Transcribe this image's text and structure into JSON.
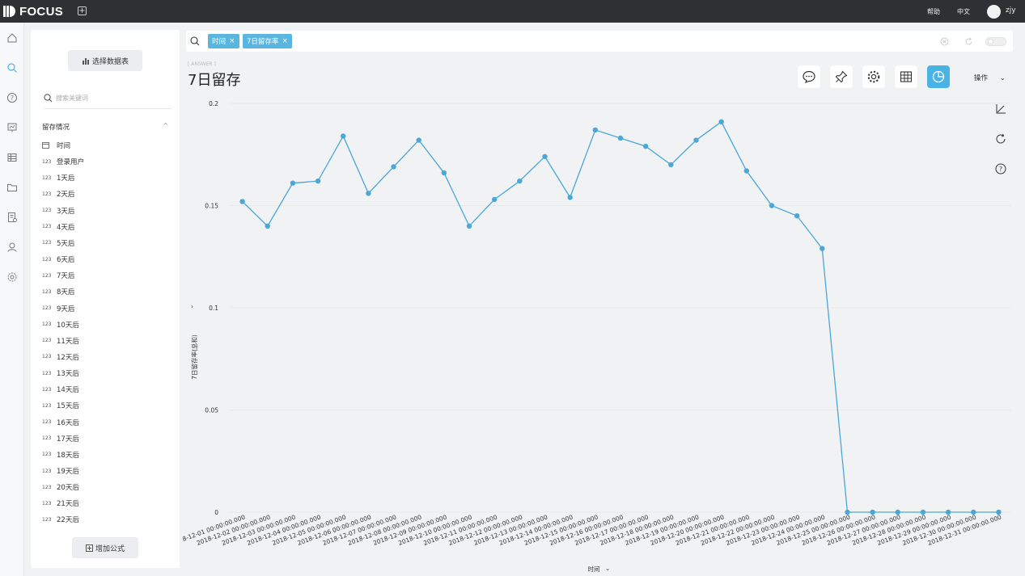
{
  "app": {
    "name": "FOCUS"
  },
  "topbar": {
    "help": "帮助",
    "lang": "中文",
    "user": "zjy"
  },
  "sidebar": {
    "select_table": "选择数据表",
    "search_placeholder": "搜索关键词",
    "group_title": "留存情况",
    "fields": [
      {
        "type": "date",
        "name": "时间"
      },
      {
        "type": "123",
        "name": "登录用户"
      },
      {
        "type": "123",
        "name": "1天后"
      },
      {
        "type": "123",
        "name": "2天后"
      },
      {
        "type": "123",
        "name": "3天后"
      },
      {
        "type": "123",
        "name": "4天后"
      },
      {
        "type": "123",
        "name": "5天后"
      },
      {
        "type": "123",
        "name": "6天后"
      },
      {
        "type": "123",
        "name": "7天后"
      },
      {
        "type": "123",
        "name": "8天后"
      },
      {
        "type": "123",
        "name": "9天后"
      },
      {
        "type": "123",
        "name": "10天后"
      },
      {
        "type": "123",
        "name": "11天后"
      },
      {
        "type": "123",
        "name": "12天后"
      },
      {
        "type": "123",
        "name": "13天后"
      },
      {
        "type": "123",
        "name": "14天后"
      },
      {
        "type": "123",
        "name": "15天后"
      },
      {
        "type": "123",
        "name": "16天后"
      },
      {
        "type": "123",
        "name": "17天后"
      },
      {
        "type": "123",
        "name": "18天后"
      },
      {
        "type": "123",
        "name": "19天后"
      },
      {
        "type": "123",
        "name": "20天后"
      },
      {
        "type": "123",
        "name": "21天后"
      },
      {
        "type": "123",
        "name": "22天后"
      }
    ],
    "add_formula": "增加公式"
  },
  "search": {
    "tokens": [
      "时间",
      "7日留存率"
    ]
  },
  "main": {
    "answer_tag": "[ ANSWER ]",
    "title": "7日留存",
    "ops_label": "操作"
  },
  "colors": {
    "accent": "#4ab3e6",
    "line": "#4aa7d6",
    "topbar": "#2f3033"
  },
  "chart_data": {
    "type": "line",
    "title": "",
    "xlabel": "时间",
    "ylabel": "7日留存率(总和)",
    "ylim": [
      0,
      0.2
    ],
    "y_ticks": [
      "0",
      "0.05",
      "0.1",
      "0.15",
      "0.2"
    ],
    "grid": true,
    "categories": [
      "2018-12-01 00:00:00.000",
      "2018-12-02 00:00:00.000",
      "2018-12-03 00:00:00.000",
      "2018-12-04 00:00:00.000",
      "2018-12-05 00:00:00.000",
      "2018-12-06 00:00:00.000",
      "2018-12-07 00:00:00.000",
      "2018-12-08 00:00:00.000",
      "2018-12-09 00:00:00.000",
      "2018-12-10 00:00:00.000",
      "2018-12-11 00:00:00.000",
      "2018-12-12 00:00:00.000",
      "2018-12-13 00:00:00.000",
      "2018-12-14 00:00:00.000",
      "2018-12-15 00:00:00.000",
      "2018-12-16 00:00:00.000",
      "2018-12-17 00:00:00.000",
      "2018-12-18 00:00:00.000",
      "2018-12-19 00:00:00.000",
      "2018-12-20 00:00:00.000",
      "2018-12-21 00:00:00.000",
      "2018-12-22 00:00:00.000",
      "2018-12-23 00:00:00.000",
      "2018-12-24 00:00:00.000",
      "2018-12-25 00:00:00.000",
      "2018-12-26 00:00:00.000",
      "2018-12-27 00:00:00.000",
      "2018-12-28 00:00:00.000",
      "2018-12-29 00:00:00.000",
      "2018-12-30 00:00:00.000",
      "2018-12-31 00:00:00.000"
    ],
    "series": [
      {
        "name": "7日留存率(总和)",
        "values": [
          0.152,
          0.14,
          0.161,
          0.162,
          0.184,
          0.156,
          0.169,
          0.182,
          0.166,
          0.14,
          0.153,
          0.162,
          0.174,
          0.154,
          0.187,
          0.183,
          0.179,
          0.17,
          0.182,
          0.191,
          0.167,
          0.15,
          0.145,
          0.129,
          0,
          0,
          0,
          0,
          0,
          0,
          0
        ]
      }
    ]
  }
}
